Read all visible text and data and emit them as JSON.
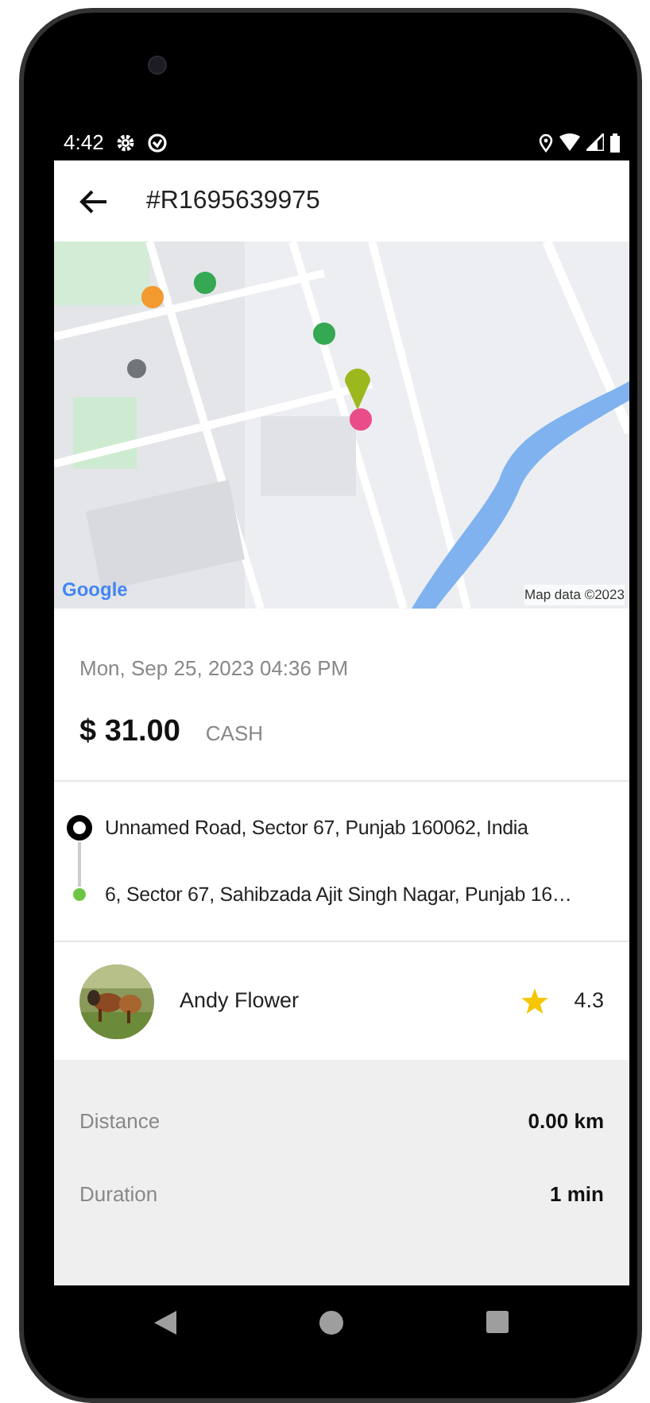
{
  "status_bar": {
    "time": "4:42"
  },
  "app_bar": {
    "title": "#R1695639975"
  },
  "map": {
    "logo": "Google",
    "attribution": "Map data ©2023"
  },
  "trip": {
    "datetime": "Mon, Sep 25, 2023 04:36 PM",
    "fare": "$ 31.00",
    "payment": "CASH"
  },
  "route": [
    {
      "kind": "pickup",
      "address": "Unnamed Road, Sector 67, Punjab 160062, India"
    },
    {
      "kind": "dropoff",
      "address": "6, Sector 67, Sahibzada Ajit Singh Nagar, Punjab 16…"
    }
  ],
  "driver": {
    "name": "Andy Flower",
    "rating": "4.3"
  },
  "stats": [
    {
      "label": "Distance",
      "value": "0.00 km"
    },
    {
      "label": "Duration",
      "value": "1 min"
    }
  ]
}
